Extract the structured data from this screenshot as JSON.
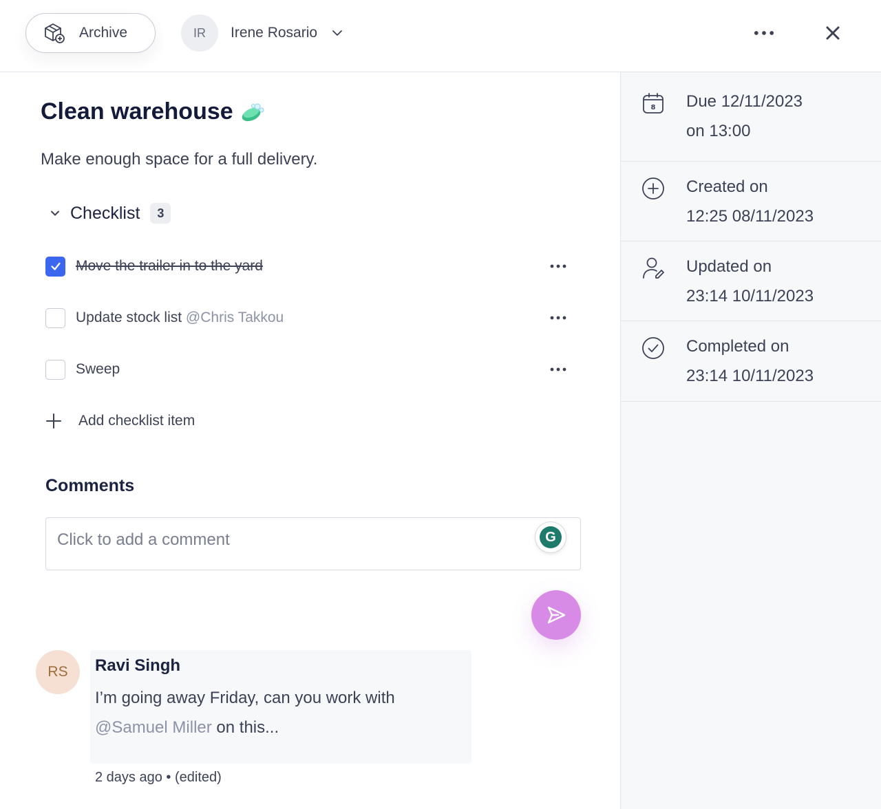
{
  "header": {
    "archive_label": "Archive",
    "assignee_initials": "IR",
    "assignee_name": "Irene Rosario"
  },
  "task": {
    "title": "Clean warehouse",
    "description": "Make enough space for a full delivery."
  },
  "checklist": {
    "title": "Checklist",
    "count": "3",
    "items": [
      {
        "text": "Move the trailer in to the yard",
        "mention": "",
        "checked": true
      },
      {
        "text": "Update stock list",
        "mention": "@Chris Takkou",
        "checked": false
      },
      {
        "text": "Sweep",
        "mention": "",
        "checked": false
      }
    ],
    "add_label": "Add checklist item"
  },
  "comments": {
    "title": "Comments",
    "placeholder": "Click to add a comment",
    "grammarly_letter": "G",
    "list": [
      {
        "initials": "RS",
        "author": "Ravi Singh",
        "text_before": "I’m going away Friday, can you work with",
        "mention": "@Samuel Miller",
        "text_after": "on this...",
        "meta": "2 days ago • (edited)"
      }
    ]
  },
  "sidebar": {
    "due": {
      "line1": "Due 12/11/2023",
      "line2": "on 13:00",
      "calendar_day": "8"
    },
    "created": {
      "line1": "Created on",
      "line2": "12:25 08/11/2023"
    },
    "updated": {
      "line1": "Updated on",
      "line2": "23:14 10/11/2023"
    },
    "completed": {
      "line1": "Completed on",
      "line2": "23:14 10/11/2023"
    }
  },
  "colors": {
    "accent_blue": "#3a66f0",
    "send_purple": "#d78ae6",
    "text_dark": "#141a3a",
    "mention_gray": "#8d92a8"
  },
  "icons": [
    "archive-box-icon",
    "chevron-down-icon",
    "more-horizontal-icon",
    "close-icon",
    "soap-icon",
    "plus-icon",
    "send-icon",
    "calendar-icon",
    "plus-circle-icon",
    "user-edit-icon",
    "check-circle-icon"
  ]
}
